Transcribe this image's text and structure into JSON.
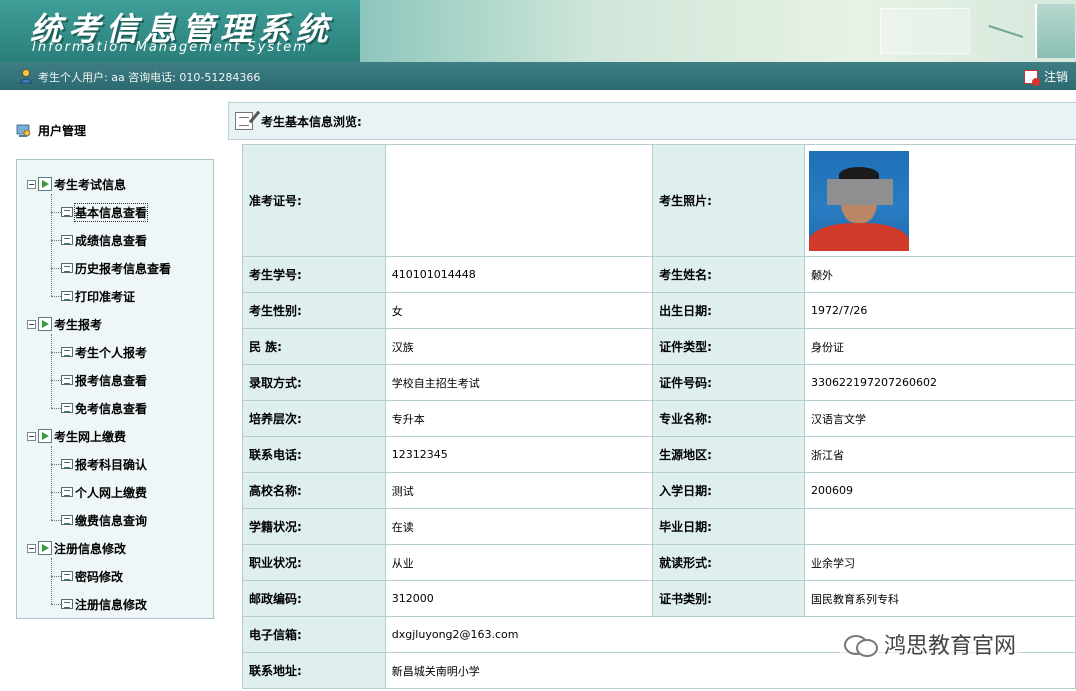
{
  "header": {
    "title": "统考信息管理系统",
    "subtitle": "Information Management System"
  },
  "userbar": {
    "user_text": "考生个人用户: aa 咨询电话: 010-51284366",
    "logout_label": "注销"
  },
  "sidebar": {
    "heading": "用户管理",
    "groups": [
      {
        "label": "考生考试信息",
        "items": [
          "基本信息查看",
          "成绩信息查看",
          "历史报考信息查看",
          "打印准考证"
        ]
      },
      {
        "label": "考生报考",
        "items": [
          "考生个人报考",
          "报考信息查看",
          "免考信息查看"
        ]
      },
      {
        "label": "考生网上缴费",
        "items": [
          "报考科目确认",
          "个人网上缴费",
          "缴费信息查询"
        ]
      },
      {
        "label": "注册信息修改",
        "items": [
          "密码修改",
          "注册信息修改"
        ]
      }
    ]
  },
  "main": {
    "heading": "考生基本信息浏览:",
    "photo_label": "考生照片:",
    "rows": [
      {
        "l1": "准考证号:",
        "v1": ""
      },
      {
        "l1": "考生学号:",
        "v1": "410101014448",
        "l2": "考生姓名:",
        "v2": "颡外"
      },
      {
        "l1": "考生性别:",
        "v1": "女",
        "l2": "出生日期:",
        "v2": "1972/7/26"
      },
      {
        "l1": "民    族:",
        "v1": "汉族",
        "l2": "证件类型:",
        "v2": "身份证"
      },
      {
        "l1": "录取方式:",
        "v1": "学校自主招生考试",
        "l2": "证件号码:",
        "v2": "330622197207260602"
      },
      {
        "l1": "培养层次:",
        "v1": "专升本",
        "l2": "专业名称:",
        "v2": "汉语言文学"
      },
      {
        "l1": "联系电话:",
        "v1": "12312345",
        "l2": "生源地区:",
        "v2": "浙江省"
      },
      {
        "l1": "高校名称:",
        "v1": "测试",
        "l2": "入学日期:",
        "v2": "200609"
      },
      {
        "l1": "学籍状况:",
        "v1": "在读",
        "l2": "毕业日期:",
        "v2": ""
      },
      {
        "l1": "职业状况:",
        "v1": "从业",
        "l2": "就读形式:",
        "v2": "业余学习"
      },
      {
        "l1": "邮政编码:",
        "v1": "312000",
        "l2": "证书类别:",
        "v2": "国民教育系列专科"
      },
      {
        "l1": "电子信箱:",
        "v1": "dxgjluyong2@163.com"
      },
      {
        "l1": "联系地址:",
        "v1": "新昌城关南明小学"
      }
    ]
  },
  "watermark": {
    "text": "鸿思教育官网"
  }
}
